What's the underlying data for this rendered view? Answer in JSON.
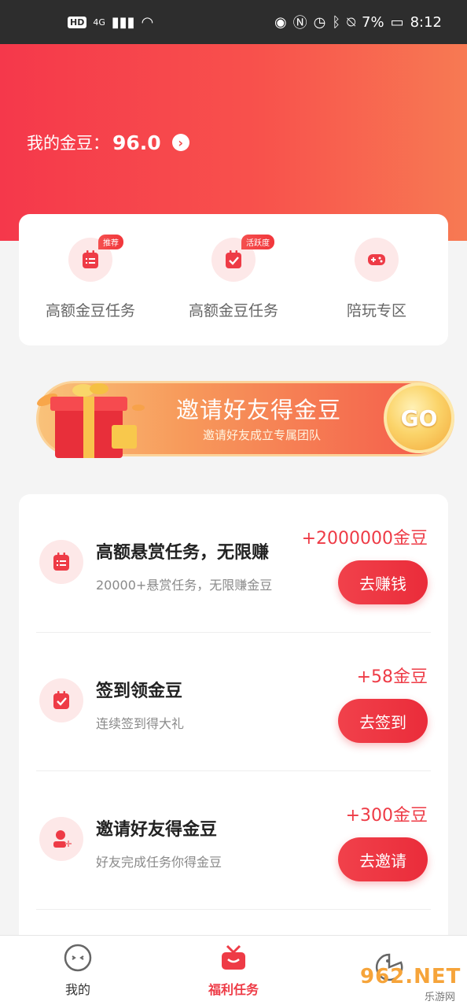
{
  "status_bar": {
    "network_badge": "HD",
    "signal_label": "4G",
    "battery": "7%",
    "time": "8:12"
  },
  "header": {
    "beans_label": "我的金豆：",
    "beans_value": "96.0"
  },
  "quick_entries": [
    {
      "label": "高额金豆任务",
      "tag": "推荐",
      "icon": "task-list-icon"
    },
    {
      "label": "高额金豆任务",
      "tag": "活跃度",
      "icon": "task-check-icon"
    },
    {
      "label": "陪玩专区",
      "tag": "",
      "icon": "gamepad-icon"
    }
  ],
  "banner": {
    "title": "邀请好友得金豆",
    "subtitle": "邀请好友成立专属团队",
    "go_label": "GO"
  },
  "tasks": [
    {
      "title": "高额悬赏任务，无限赚",
      "desc": "20000+悬赏任务，无限赚金豆",
      "reward": "+2000000金豆",
      "button": "去赚钱",
      "icon": "task-list-icon"
    },
    {
      "title": "签到领金豆",
      "desc": "连续签到得大礼",
      "reward": "+58金豆",
      "button": "去签到",
      "icon": "calendar-check-icon"
    },
    {
      "title": "邀请好友得金豆",
      "desc": "好友完成任务你得金豆",
      "reward": "+300金豆",
      "button": "去邀请",
      "icon": "add-user-icon"
    }
  ],
  "bottom_nav": [
    {
      "label": "我的",
      "icon": "face-icon",
      "active": false
    },
    {
      "label": "福利任务",
      "icon": "gift-tv-icon",
      "active": true
    },
    {
      "label": "",
      "icon": "pacman-icon",
      "active": false
    }
  ],
  "watermark": {
    "text": "962.NET",
    "sub": "乐游网"
  },
  "colors": {
    "accent": "#ee3b46",
    "header_start": "#f5384b",
    "header_end": "#f77a53",
    "icon_bg": "#fde8e8"
  }
}
